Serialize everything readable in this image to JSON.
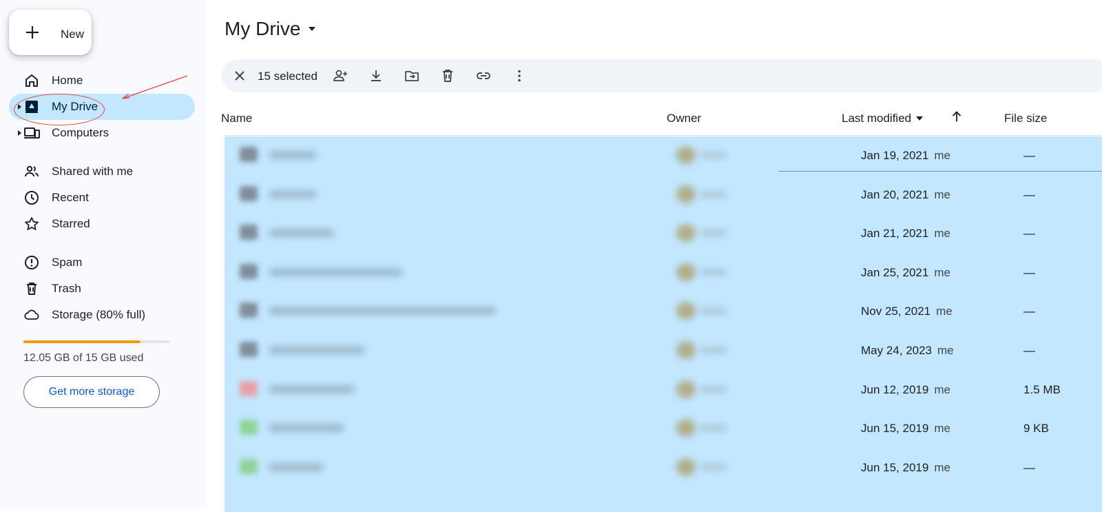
{
  "sidebar": {
    "new_label": "New",
    "nav": [
      {
        "label": "Home",
        "icon": "home-icon"
      },
      {
        "label": "My Drive",
        "icon": "my-drive-icon",
        "active": true
      },
      {
        "label": "Computers",
        "icon": "computers-icon"
      },
      {
        "label": "Shared with me",
        "icon": "shared-icon"
      },
      {
        "label": "Recent",
        "icon": "clock-icon"
      },
      {
        "label": "Starred",
        "icon": "star-icon"
      },
      {
        "label": "Spam",
        "icon": "spam-icon"
      },
      {
        "label": "Trash",
        "icon": "trash-icon"
      },
      {
        "label": "Storage (80% full)",
        "icon": "cloud-icon"
      }
    ],
    "storage_used_fraction": 0.8,
    "storage_text": "12.05 GB of 15 GB used",
    "get_storage_label": "Get more storage"
  },
  "main": {
    "title": "My Drive",
    "toolbar": {
      "selected_count": "15 selected"
    },
    "columns": {
      "name": "Name",
      "owner": "Owner",
      "modified": "Last modified",
      "size": "File size"
    },
    "rows": [
      {
        "date": "Jan 19, 2021",
        "by": "me",
        "size": "—",
        "icon_color": "#7f8d99"
      },
      {
        "date": "Jan 20, 2021",
        "by": "me",
        "size": "—",
        "icon_color": "#7f8d99"
      },
      {
        "date": "Jan 21, 2021",
        "by": "me",
        "size": "—",
        "icon_color": "#7f8d99"
      },
      {
        "date": "Jan 25, 2021",
        "by": "me",
        "size": "—",
        "icon_color": "#7f8d99"
      },
      {
        "date": "Nov 25, 2021",
        "by": "me",
        "size": "—",
        "icon_color": "#7f8d99"
      },
      {
        "date": "May 24, 2023",
        "by": "me",
        "size": "—",
        "icon_color": "#7f8d99"
      },
      {
        "date": "Jun 12, 2019",
        "by": "me",
        "size": "1.5 MB",
        "icon_color": "#e8a0a8"
      },
      {
        "date": "Jun 15, 2019",
        "by": "me",
        "size": "9 KB",
        "icon_color": "#8fd49a"
      },
      {
        "date": "Jun 15, 2019",
        "by": "me",
        "size": "—",
        "icon_color": "#8fd49a"
      }
    ]
  },
  "colors": {
    "accent": "#0b57d0",
    "selection": "#c2e7ff",
    "storage_bar": "#f29900",
    "annotation": "#e0443e"
  }
}
